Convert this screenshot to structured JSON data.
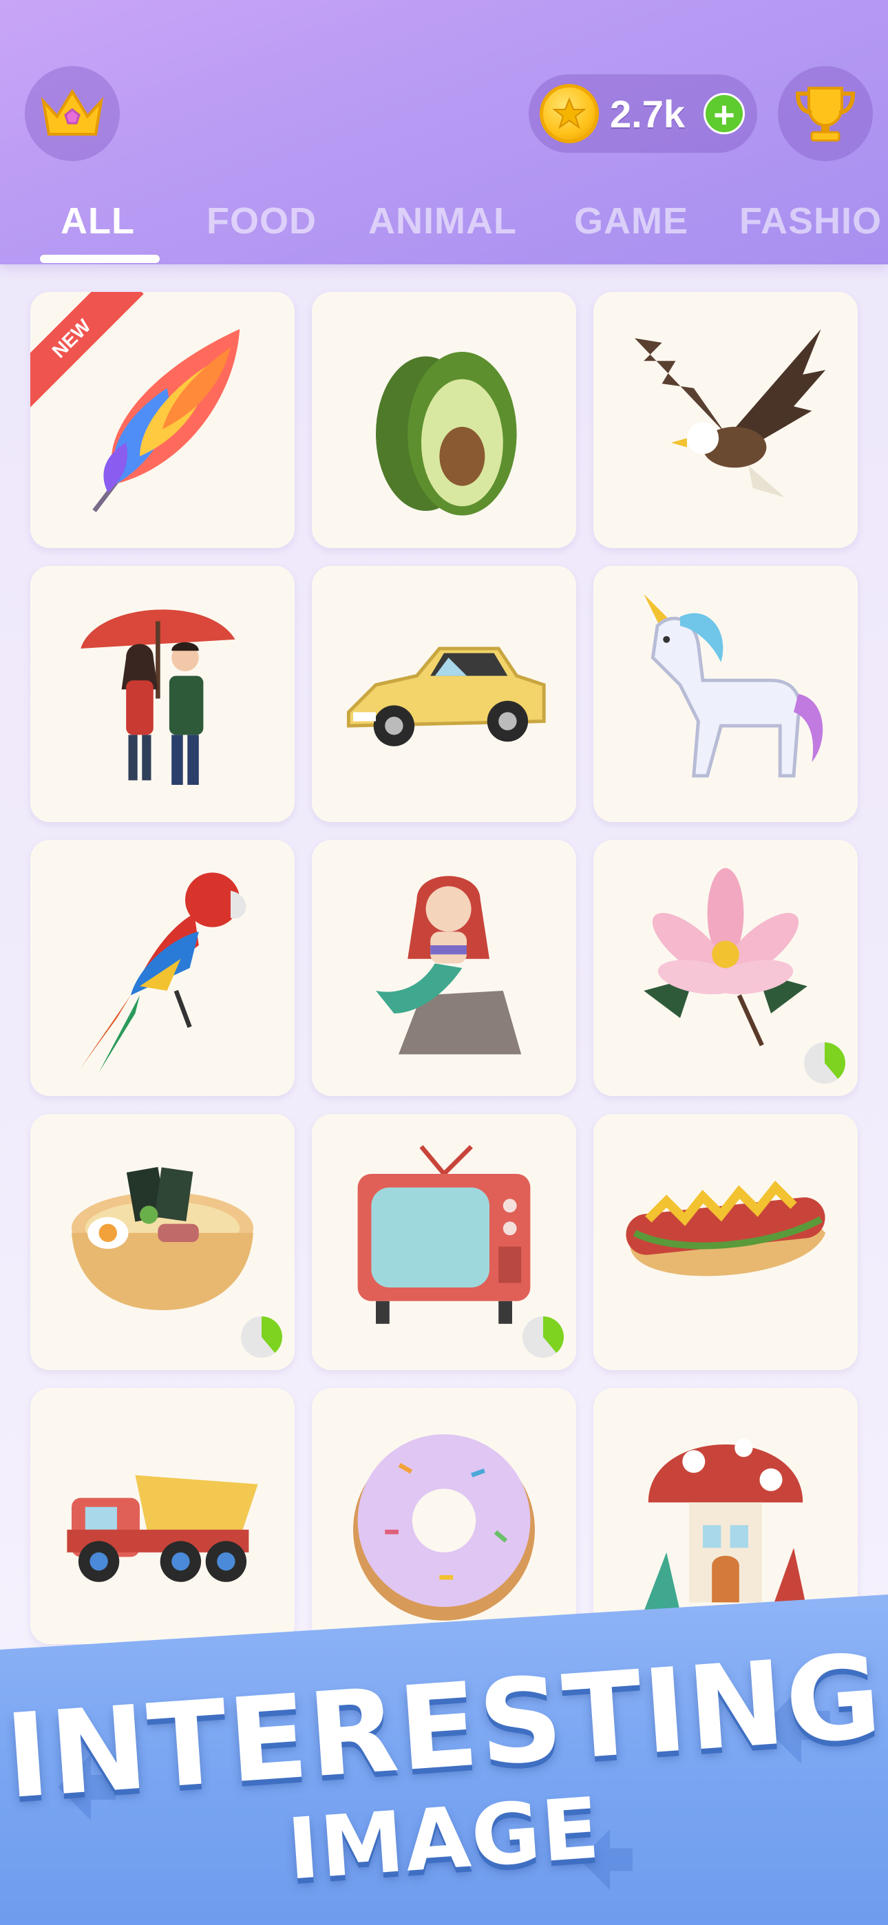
{
  "header": {
    "coins": "2.7k",
    "plus_label": "+"
  },
  "tabs": [
    {
      "label": "ALL",
      "active": true
    },
    {
      "label": "FOOD",
      "active": false
    },
    {
      "label": "ANIMAL",
      "active": false
    },
    {
      "label": "GAME",
      "active": false
    },
    {
      "label": "FASHIO",
      "active": false
    }
  ],
  "grid": {
    "items": [
      {
        "name": "rainbow-feather",
        "badge": "NEW"
      },
      {
        "name": "avocado"
      },
      {
        "name": "eagle"
      },
      {
        "name": "couple-umbrella"
      },
      {
        "name": "yellow-car"
      },
      {
        "name": "unicorn"
      },
      {
        "name": "parrot"
      },
      {
        "name": "mermaid"
      },
      {
        "name": "lotus-flower",
        "progress": 0.35
      },
      {
        "name": "ramen-bowl",
        "progress": 0.4
      },
      {
        "name": "retro-tv",
        "progress": 0.35
      },
      {
        "name": "hot-dog"
      },
      {
        "name": "dump-truck"
      },
      {
        "name": "donut"
      },
      {
        "name": "mushroom-house"
      }
    ]
  },
  "banner": {
    "line1": "INTERESTING",
    "line2": "IMAGE"
  }
}
